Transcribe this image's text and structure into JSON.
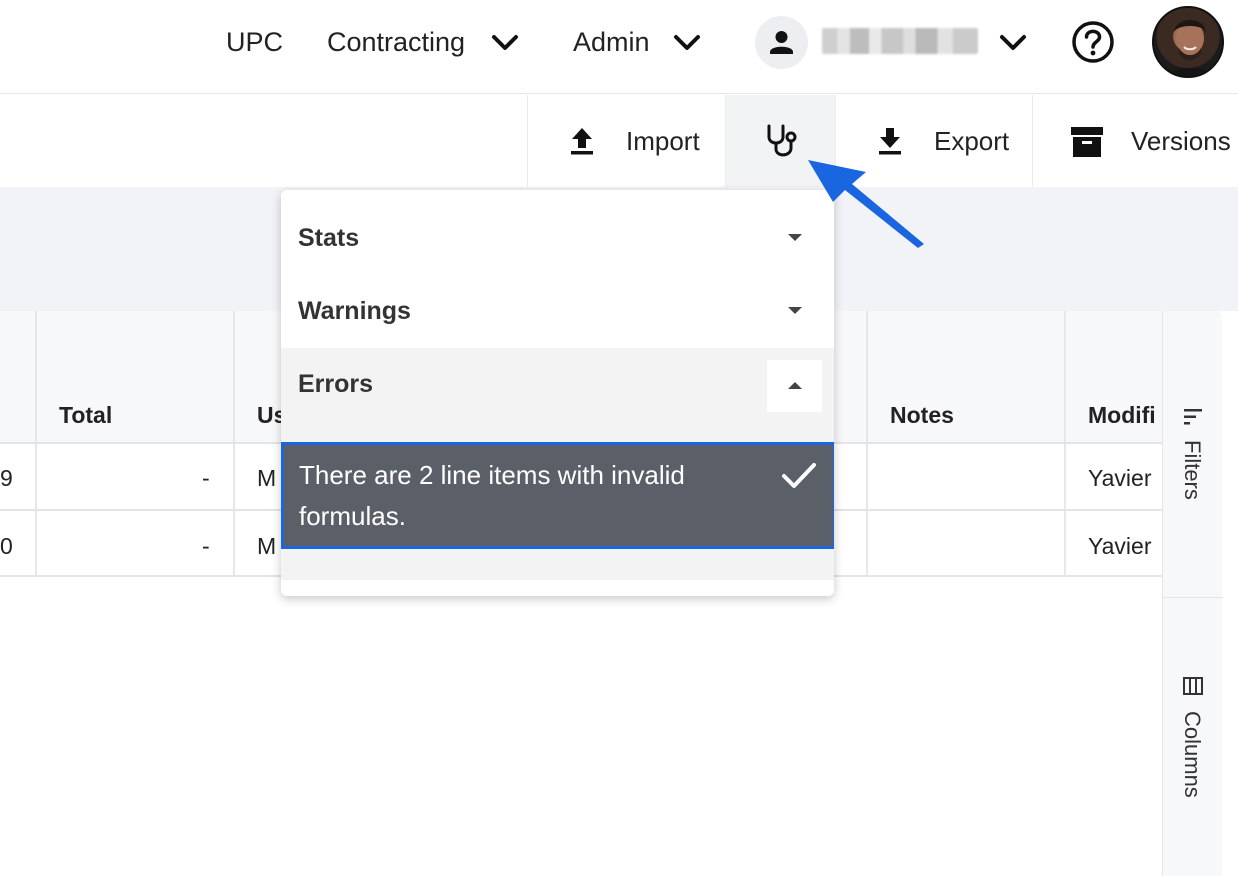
{
  "nav": {
    "upc": "UPC",
    "contracting": "Contracting",
    "admin": "Admin",
    "user_name": ""
  },
  "toolbar": {
    "import": "Import",
    "export": "Export",
    "versions": "Versions",
    "health_icon": "stethoscope-icon"
  },
  "grid": {
    "headers": [
      "Total",
      "Us",
      "Notes",
      "Modifi"
    ],
    "rows": [
      {
        "lead": "9",
        "total": "-",
        "user": "M",
        "modified": "Yavier"
      },
      {
        "lead": "0",
        "total": "-",
        "user": "M",
        "modified": "Yavier"
      }
    ]
  },
  "side": {
    "filters": "Filters",
    "columns": "Columns"
  },
  "dropdown": {
    "stats": "Stats",
    "warnings": "Warnings",
    "errors": "Errors",
    "error_message": "There are 2 line items with invalid formulas."
  },
  "colors": {
    "accent": "#1a66e0",
    "error_item_bg": "#5b6068",
    "band": "#f2f3f6"
  }
}
